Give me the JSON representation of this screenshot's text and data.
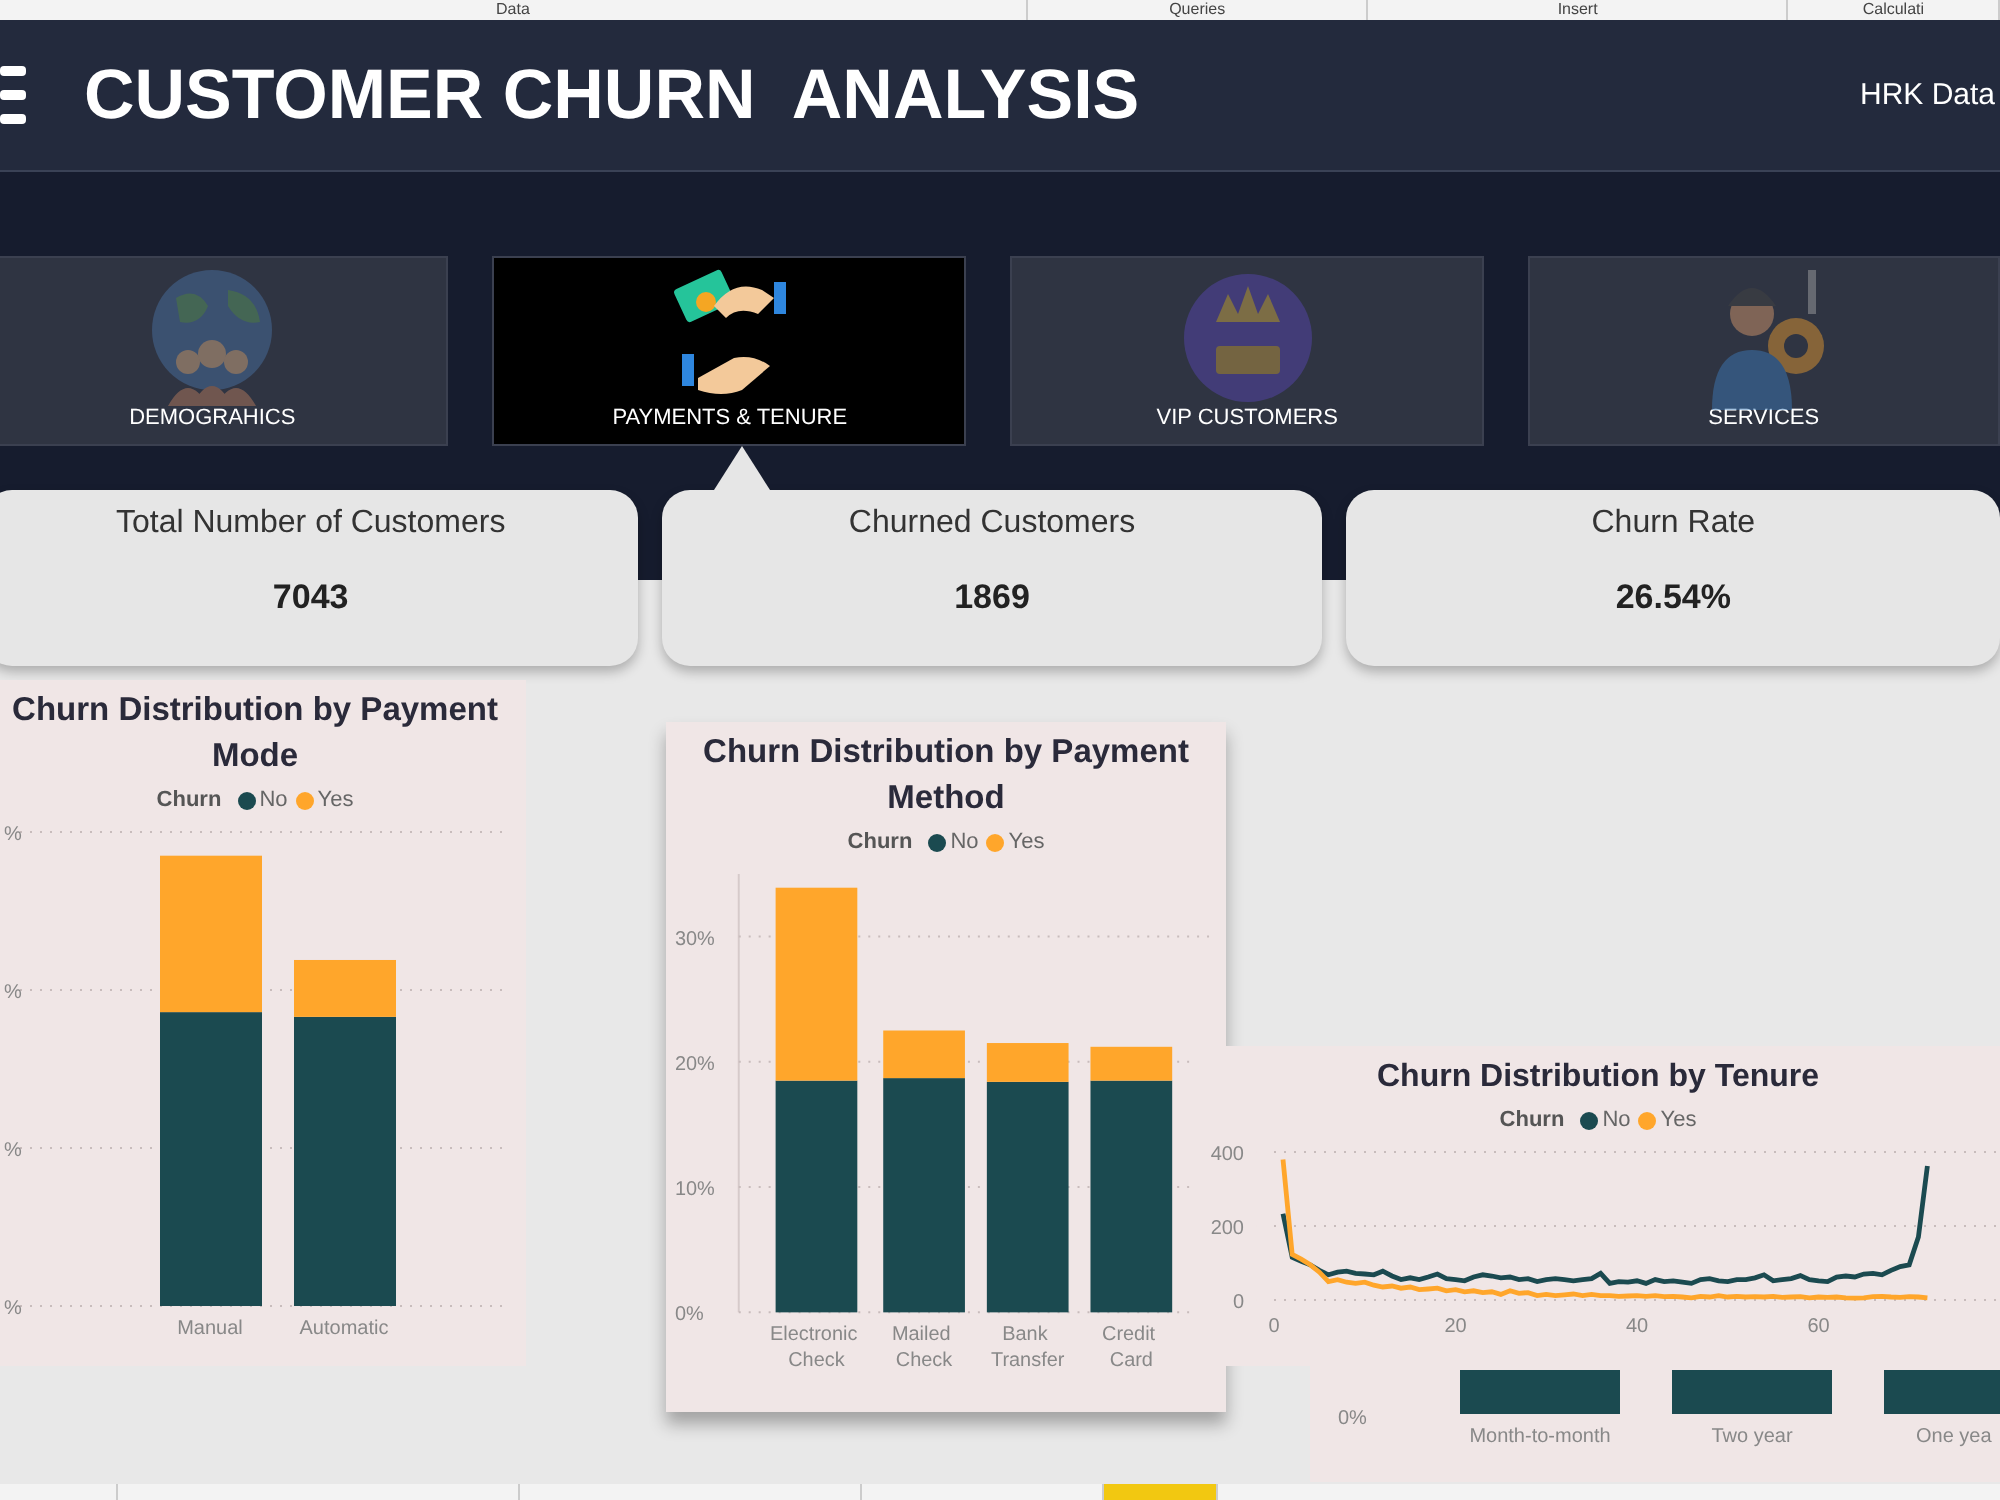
{
  "ribbon": {
    "groups": [
      "Data",
      "Queries",
      "Insert",
      "Calculati"
    ]
  },
  "header": {
    "title": "CUSTOMER CHURN  ANALYSIS",
    "account": "HRK Data"
  },
  "nav_tiles": [
    {
      "label": "DEMOGRAHICS",
      "kind": "globe",
      "selected": false
    },
    {
      "label": "PAYMENTS & TENURE",
      "kind": "payment",
      "selected": true
    },
    {
      "label": "VIP CUSTOMERS",
      "kind": "vip",
      "selected": false
    },
    {
      "label": "SERVICES",
      "kind": "services",
      "selected": false
    }
  ],
  "kpi_cards": [
    {
      "label": "Total Number of Customers",
      "value": "7043"
    },
    {
      "label": "Churned Customers",
      "value": "1869"
    },
    {
      "label": "Churn Rate",
      "value": "26.54%"
    }
  ],
  "payment_mode_chart": {
    "title": "Churn Distribution by Payment Mode",
    "legend_title": "Churn",
    "legend": [
      {
        "name": "No",
        "color": "#1b4a50"
      },
      {
        "name": "Yes",
        "color": "#ffa62b"
      }
    ],
    "axis_label_fragments": [
      "%",
      "%",
      "%",
      "%"
    ],
    "categories": [
      "Manual",
      "Automatic"
    ]
  },
  "payment_method_chart": {
    "legend_title": "Churn",
    "chart_data": {
      "type": "bar",
      "title": "Churn Distribution by Payment Method",
      "categories": [
        "Electronic Check",
        "Mailed Check",
        "Bank Transfer",
        "Credit Card"
      ],
      "stacked": true,
      "grid": true,
      "ylim": [
        0,
        35
      ],
      "yticks": [
        {
          "value": 0,
          "label": "0%"
        },
        {
          "value": 10,
          "label": "10%"
        },
        {
          "value": 20,
          "label": "20%"
        },
        {
          "value": 30,
          "label": "30%"
        }
      ],
      "series": [
        {
          "name": "No",
          "color": "#1b4a50",
          "values": [
            18.5,
            18.7,
            18.4,
            18.5
          ]
        },
        {
          "name": "Yes",
          "color": "#ffa62b",
          "values": [
            15.4,
            3.8,
            3.1,
            2.7
          ]
        }
      ]
    }
  },
  "tenure_chart": {
    "legend_title": "Churn",
    "chart_data": {
      "type": "line",
      "title": "Churn Distribution by Tenure",
      "grid": true,
      "xlim": [
        0,
        80
      ],
      "ylim": [
        0,
        400
      ],
      "xticks": [
        0,
        20,
        40,
        60
      ],
      "yticks": [
        0,
        200,
        400
      ],
      "x": [
        1,
        2,
        3,
        4,
        5,
        6,
        7,
        8,
        9,
        10,
        11,
        12,
        13,
        14,
        15,
        16,
        17,
        18,
        19,
        20,
        21,
        22,
        23,
        24,
        25,
        26,
        27,
        28,
        29,
        30,
        31,
        32,
        33,
        34,
        35,
        36,
        37,
        38,
        39,
        40,
        41,
        42,
        43,
        44,
        45,
        46,
        47,
        48,
        49,
        50,
        51,
        52,
        53,
        54,
        55,
        56,
        57,
        58,
        59,
        60,
        61,
        62,
        63,
        64,
        65,
        66,
        67,
        68,
        69,
        70,
        71,
        72
      ],
      "series": [
        {
          "name": "No",
          "color": "#1b4a50",
          "values": [
            233,
            115,
            105,
            95,
            80,
            68,
            75,
            78,
            72,
            70,
            68,
            78,
            65,
            55,
            60,
            55,
            62,
            70,
            58,
            55,
            52,
            62,
            68,
            65,
            60,
            62,
            55,
            58,
            50,
            55,
            58,
            55,
            52,
            55,
            58,
            72,
            45,
            50,
            48,
            52,
            45,
            55,
            50,
            52,
            48,
            45,
            55,
            58,
            52,
            50,
            55,
            55,
            60,
            68,
            52,
            55,
            58,
            66,
            55,
            52,
            50,
            62,
            65,
            62,
            70,
            72,
            68,
            80,
            90,
            95,
            170,
            362
          ]
        },
        {
          "name": "Yes",
          "color": "#ffa62b",
          "values": [
            380,
            123,
            110,
            95,
            75,
            50,
            55,
            48,
            45,
            48,
            40,
            35,
            38,
            32,
            35,
            28,
            30,
            32,
            25,
            28,
            22,
            25,
            20,
            22,
            15,
            25,
            18,
            20,
            12,
            15,
            12,
            14,
            16,
            12,
            15,
            12,
            12,
            10,
            11,
            12,
            10,
            12,
            9,
            10,
            8,
            6,
            10,
            8,
            12,
            8,
            10,
            8,
            9,
            8,
            10,
            7,
            8,
            9,
            6,
            8,
            7,
            8,
            6,
            5,
            6,
            9,
            10,
            8,
            7,
            9,
            8,
            6
          ]
        }
      ]
    }
  },
  "page_tabs": [
    {
      "selected": false
    },
    {
      "selected": false
    },
    {
      "selected": false
    },
    {
      "selected": false
    },
    {
      "selected": true
    }
  ],
  "contract_chart": {
    "ytick": "0%",
    "categories": [
      "Month-to-month",
      "Two year",
      "One yea"
    ]
  }
}
